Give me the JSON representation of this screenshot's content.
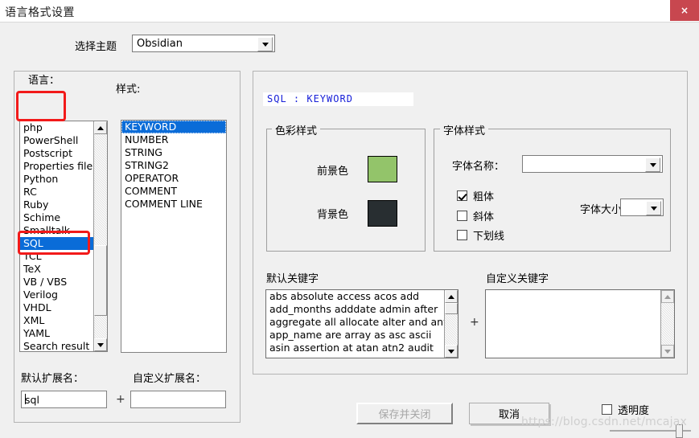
{
  "window": {
    "title": "语言格式设置",
    "close_label": "×"
  },
  "theme": {
    "label": "选择主题",
    "value": "Obsidian",
    "arrow_icon": "chevron-down-icon"
  },
  "language_panel": {
    "label": "语言：",
    "items": [
      "php",
      "PowerShell",
      "Postscript",
      "Properties file",
      "Python",
      "RC",
      "Ruby",
      "Schime",
      "Smalltalk",
      "SQL",
      "TCL",
      "TeX",
      "VB / VBS",
      "Verilog",
      "VHDL",
      "XML",
      "YAML",
      "Search result"
    ],
    "selected": "SQL"
  },
  "style_panel": {
    "label": "样式:",
    "items": [
      "KEYWORD",
      "NUMBER",
      "STRING",
      "STRING2",
      "OPERATOR",
      "COMMENT",
      "COMMENT LINE"
    ],
    "selected": "KEYWORD"
  },
  "extensions": {
    "default_label": "默认扩展名：",
    "default_value": "sql",
    "plus": "+",
    "custom_label": "自定义扩展名：",
    "custom_value": ""
  },
  "preview": {
    "header": "SQL : KEYWORD",
    "header_color": "#1921d8"
  },
  "color_style": {
    "legend": "色彩样式",
    "foreground_label": "前景色",
    "foreground_color": "#93c46a",
    "background_label": "背景色",
    "background_color": "#282e31"
  },
  "font_style": {
    "legend": "字体样式",
    "font_name_label": "字体名称：",
    "font_name_value": "",
    "font_size_label": "字体大小：",
    "font_size_value": "",
    "bold_label": "粗体",
    "bold_checked": true,
    "italic_label": "斜体",
    "italic_checked": false,
    "underline_label": "下划线",
    "underline_checked": false
  },
  "keywords": {
    "default_label": "默认关键字",
    "default_lines": [
      "abs absolute access acos add",
      "add_months adddate admin after",
      "aggregate all allocate alter and any",
      "app_name are array as asc ascii",
      "asin assertion at atan atn2 audit"
    ],
    "plus": "+",
    "custom_label": "自定义关键字",
    "custom_lines": []
  },
  "footer": {
    "save_label": "保存并关闭",
    "save_disabled": true,
    "cancel_label": "取消",
    "transparency_label": "透明度",
    "transparency_checked": false
  },
  "watermark": "https://blog.csdn.net/mcajax"
}
